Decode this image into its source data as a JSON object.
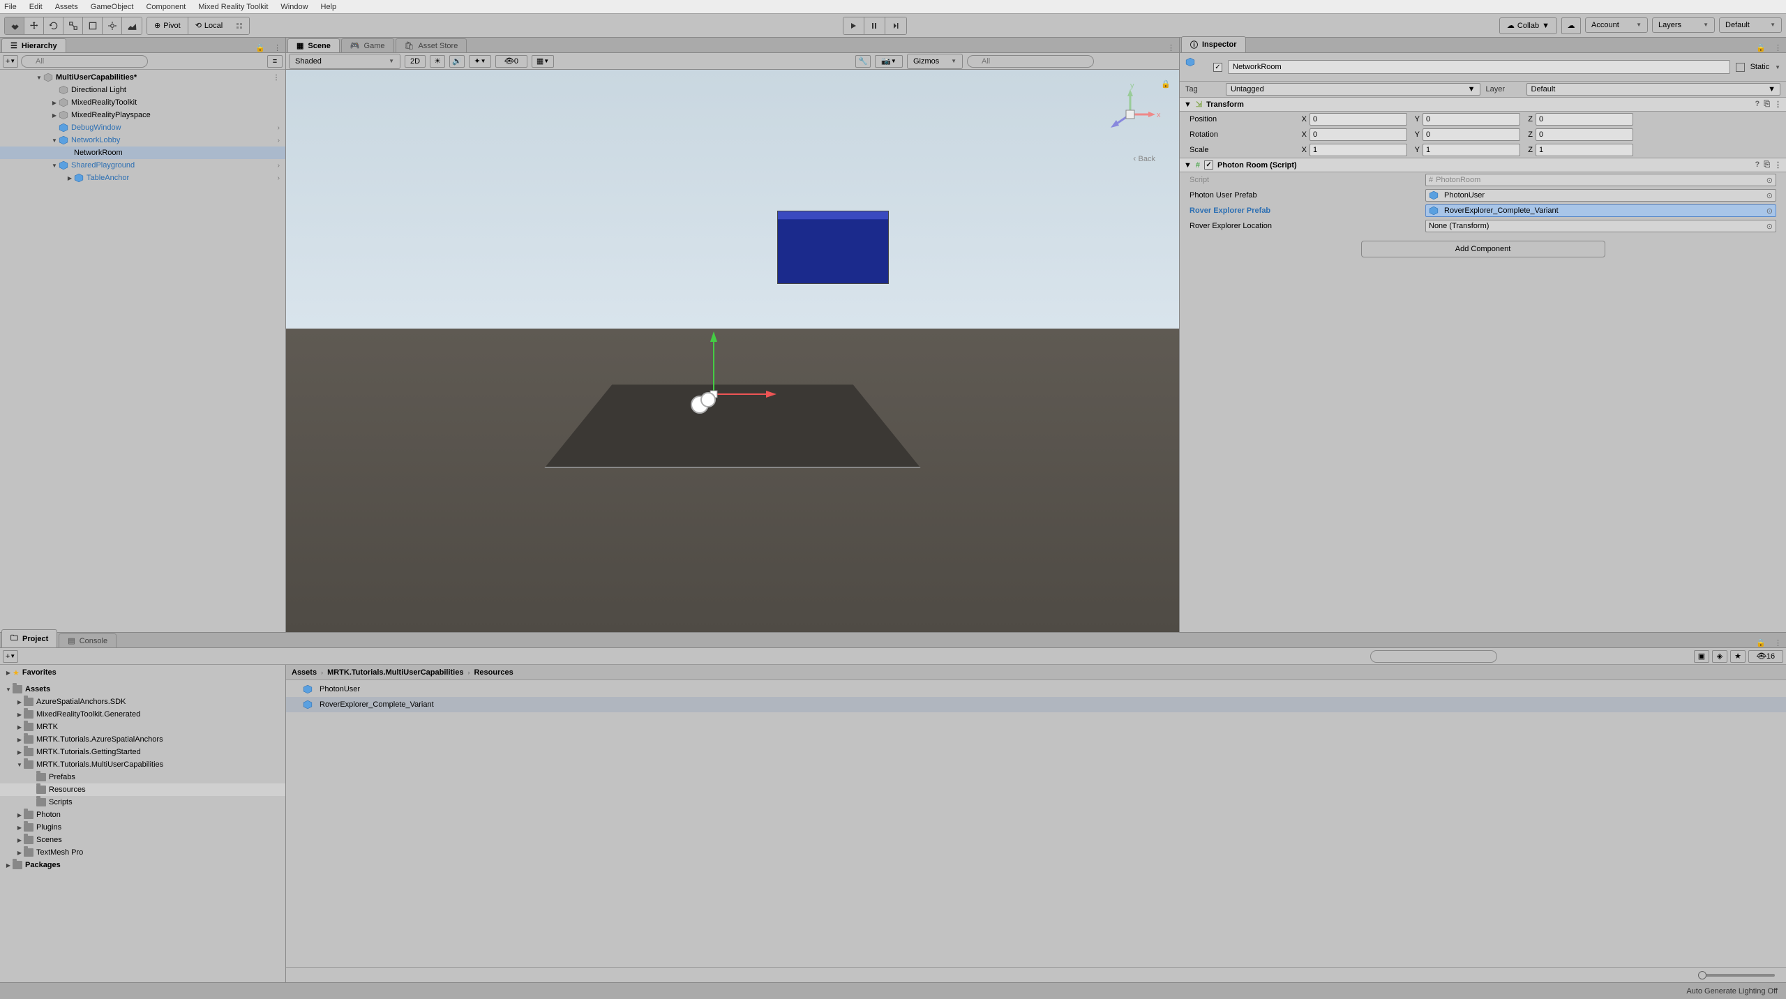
{
  "menu": [
    "File",
    "Edit",
    "Assets",
    "GameObject",
    "Component",
    "Mixed Reality Toolkit",
    "Window",
    "Help"
  ],
  "toolbar": {
    "pivot": "Pivot",
    "local": "Local",
    "collab": "Collab",
    "account": "Account",
    "layers": "Layers",
    "layout": "Default"
  },
  "hierarchy": {
    "title": "Hierarchy",
    "search_ph": "All",
    "scene": "MultiUserCapabilities*",
    "items": [
      {
        "name": "Directional Light",
        "depth": 2,
        "cube": "gray"
      },
      {
        "name": "MixedRealityToolkit",
        "depth": 2,
        "cube": "gray",
        "hasChildren": true
      },
      {
        "name": "MixedRealityPlayspace",
        "depth": 2,
        "cube": "gray",
        "hasChildren": true
      },
      {
        "name": "DebugWindow",
        "depth": 2,
        "cube": "blue",
        "blueText": true,
        "rchev": true
      },
      {
        "name": "NetworkLobby",
        "depth": 2,
        "cube": "blue",
        "blueText": true,
        "rchev": true,
        "expanded": true
      },
      {
        "name": "NetworkRoom",
        "depth": 3,
        "selected": true
      },
      {
        "name": "SharedPlayground",
        "depth": 2,
        "cube": "blue",
        "blueText": true,
        "rchev": true,
        "expanded": true
      },
      {
        "name": "TableAnchor",
        "depth": 3,
        "cube": "blue",
        "blueText": true,
        "rchev": true,
        "hasChildren": true
      }
    ]
  },
  "scene_tabs": {
    "scene": "Scene",
    "game": "Game",
    "assetstore": "Asset Store"
  },
  "scene_toolbar": {
    "shading": "Shaded",
    "mode2d": "2D",
    "count": "0",
    "gizmos": "Gizmos",
    "all": "All",
    "back": "Back"
  },
  "inspector": {
    "title": "Inspector",
    "name": "NetworkRoom",
    "static": "Static",
    "tag_label": "Tag",
    "tag": "Untagged",
    "layer_label": "Layer",
    "layer": "Default",
    "transform": {
      "title": "Transform",
      "position": {
        "label": "Position",
        "x": "0",
        "y": "0",
        "z": "0"
      },
      "rotation": {
        "label": "Rotation",
        "x": "0",
        "y": "0",
        "z": "0"
      },
      "scale": {
        "label": "Scale",
        "x": "1",
        "y": "1",
        "z": "1"
      }
    },
    "script_comp": {
      "title": "Photon Room (Script)",
      "props": [
        {
          "label": "Script",
          "value": "PhotonRoom",
          "valIcon": "script"
        },
        {
          "label": "Photon User Prefab",
          "value": "PhotonUser",
          "valIcon": "prefab"
        },
        {
          "label": "Rover Explorer Prefab",
          "value": "RoverExplorer_Complete_Variant",
          "valIcon": "prefab",
          "highlight": true,
          "blueLabel": true
        },
        {
          "label": "Rover Explorer Location",
          "value": "None (Transform)"
        }
      ]
    },
    "add": "Add Component"
  },
  "project": {
    "tabs": {
      "project": "Project",
      "console": "Console"
    },
    "count": "16",
    "favorites": "Favorites",
    "assets": "Assets",
    "folders": [
      {
        "name": "AzureSpatialAnchors.SDK",
        "d": 2
      },
      {
        "name": "MixedRealityToolkit.Generated",
        "d": 2
      },
      {
        "name": "MRTK",
        "d": 2
      },
      {
        "name": "MRTK.Tutorials.AzureSpatialAnchors",
        "d": 2
      },
      {
        "name": "MRTK.Tutorials.GettingStarted",
        "d": 2
      },
      {
        "name": "MRTK.Tutorials.MultiUserCapabilities",
        "d": 2,
        "exp": true
      },
      {
        "name": "Prefabs",
        "d": 3
      },
      {
        "name": "Resources",
        "d": 3,
        "sel": true
      },
      {
        "name": "Scripts",
        "d": 3
      },
      {
        "name": "Photon",
        "d": 2
      },
      {
        "name": "Plugins",
        "d": 2
      },
      {
        "name": "Scenes",
        "d": 2
      },
      {
        "name": "TextMesh Pro",
        "d": 2
      }
    ],
    "packages": "Packages",
    "breadcrumb": [
      "Assets",
      "MRTK.Tutorials.MultiUserCapabilities",
      "Resources"
    ],
    "assets_list": [
      {
        "name": "PhotonUser"
      },
      {
        "name": "RoverExplorer_Complete_Variant",
        "sel": true
      }
    ]
  },
  "status": "Auto Generate Lighting Off"
}
